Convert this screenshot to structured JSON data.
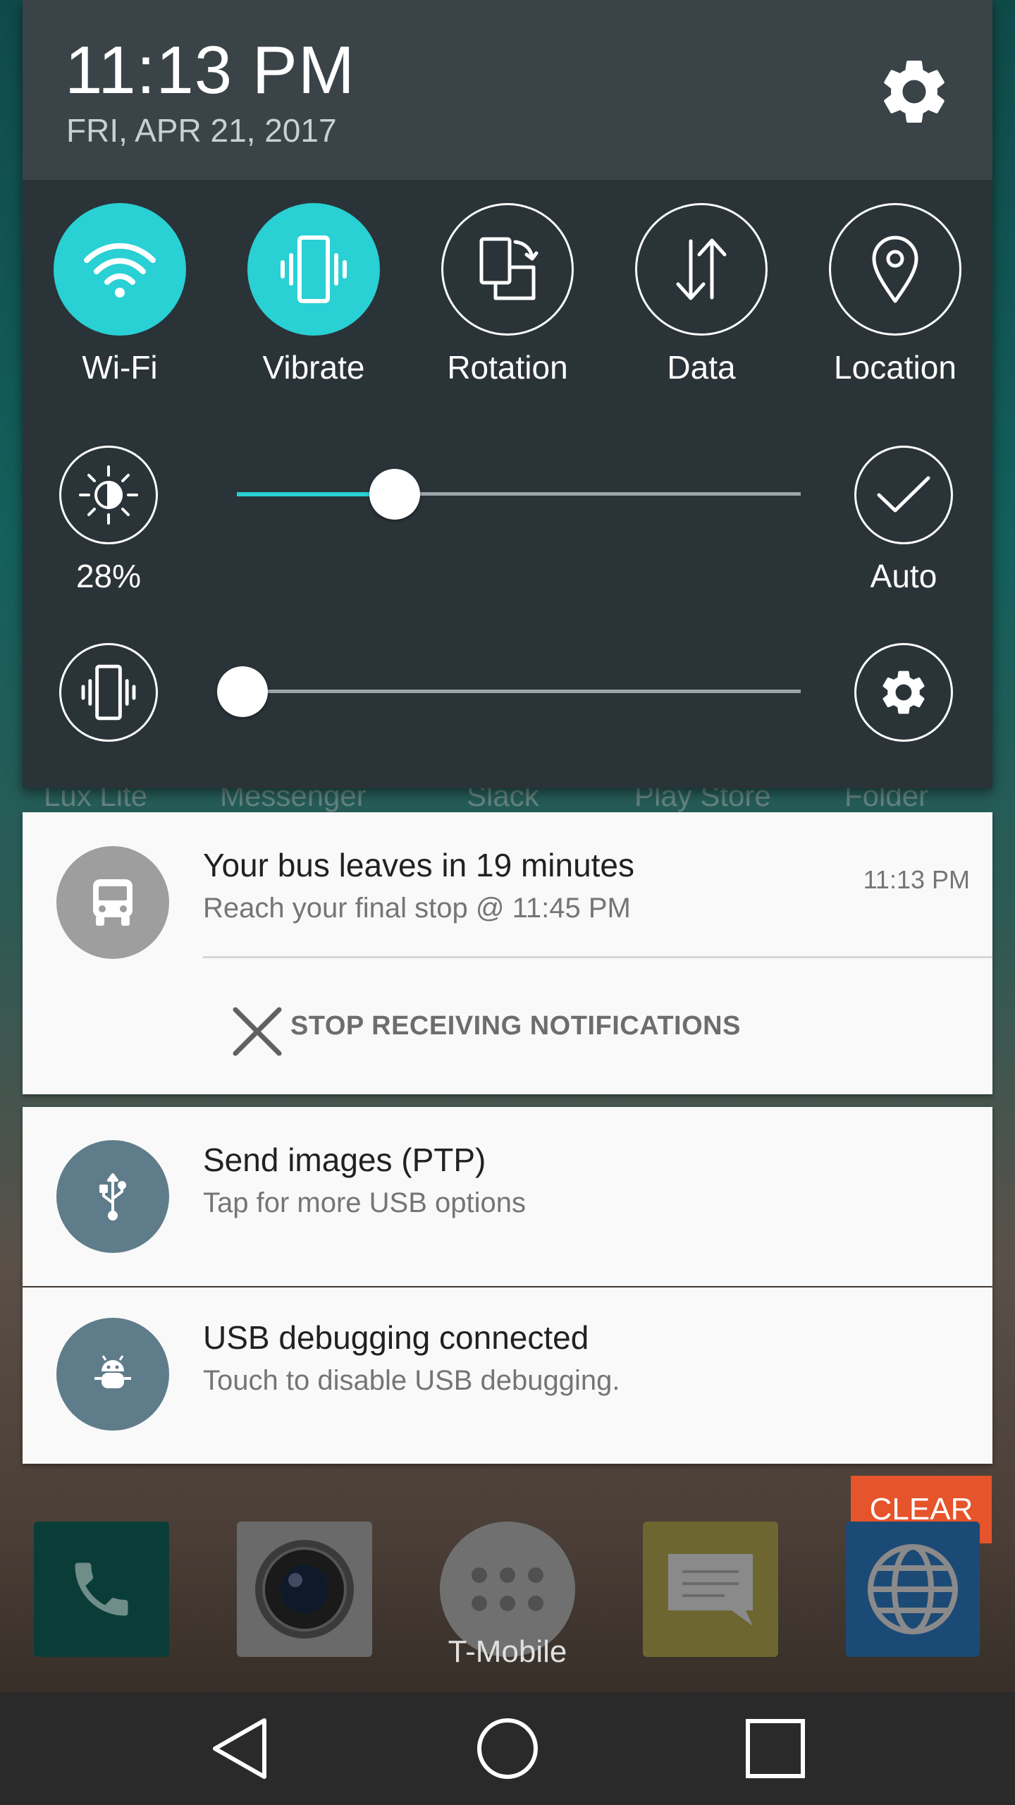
{
  "status": {
    "time": "11:13 PM",
    "date": "FRI, APR 21, 2017"
  },
  "quick_settings": [
    {
      "label": "Wi-Fi",
      "icon": "wifi-icon",
      "on": true
    },
    {
      "label": "Vibrate",
      "icon": "vibrate-icon",
      "on": true
    },
    {
      "label": "Rotation",
      "icon": "rotation-icon",
      "on": false
    },
    {
      "label": "Data",
      "icon": "data-icon",
      "on": false
    },
    {
      "label": "Location",
      "icon": "location-icon",
      "on": false
    }
  ],
  "brightness": {
    "label": "28%",
    "value_percent": 28,
    "auto_label": "Auto"
  },
  "volume": {
    "value_percent": 0
  },
  "background_apps": [
    "Lux Lite",
    "Messenger",
    "Slack",
    "Play Store",
    "Folder"
  ],
  "notifications": [
    {
      "title": "Your bus leaves in 19 minutes",
      "text": "Reach your final stop @ 11:45 PM",
      "time": "11:13 PM",
      "action": "STOP RECEIVING NOTIFICATIONS",
      "icon": "bus-icon",
      "icon_color": "#9e9e9e"
    },
    {
      "title": "Send images (PTP)",
      "text": "Tap for more USB options",
      "icon": "usb-icon",
      "icon_color": "#5f7c8a"
    },
    {
      "title": "USB debugging connected",
      "text": "Touch to disable USB debugging.",
      "icon": "android-debug-icon",
      "icon_color": "#5f7c8a"
    }
  ],
  "clear_label": "CLEAR",
  "carrier": "T-Mobile",
  "colors": {
    "accent": "#29d0d4",
    "clear": "#e5542a",
    "panel": "#2a3338",
    "header": "#3a4348"
  }
}
